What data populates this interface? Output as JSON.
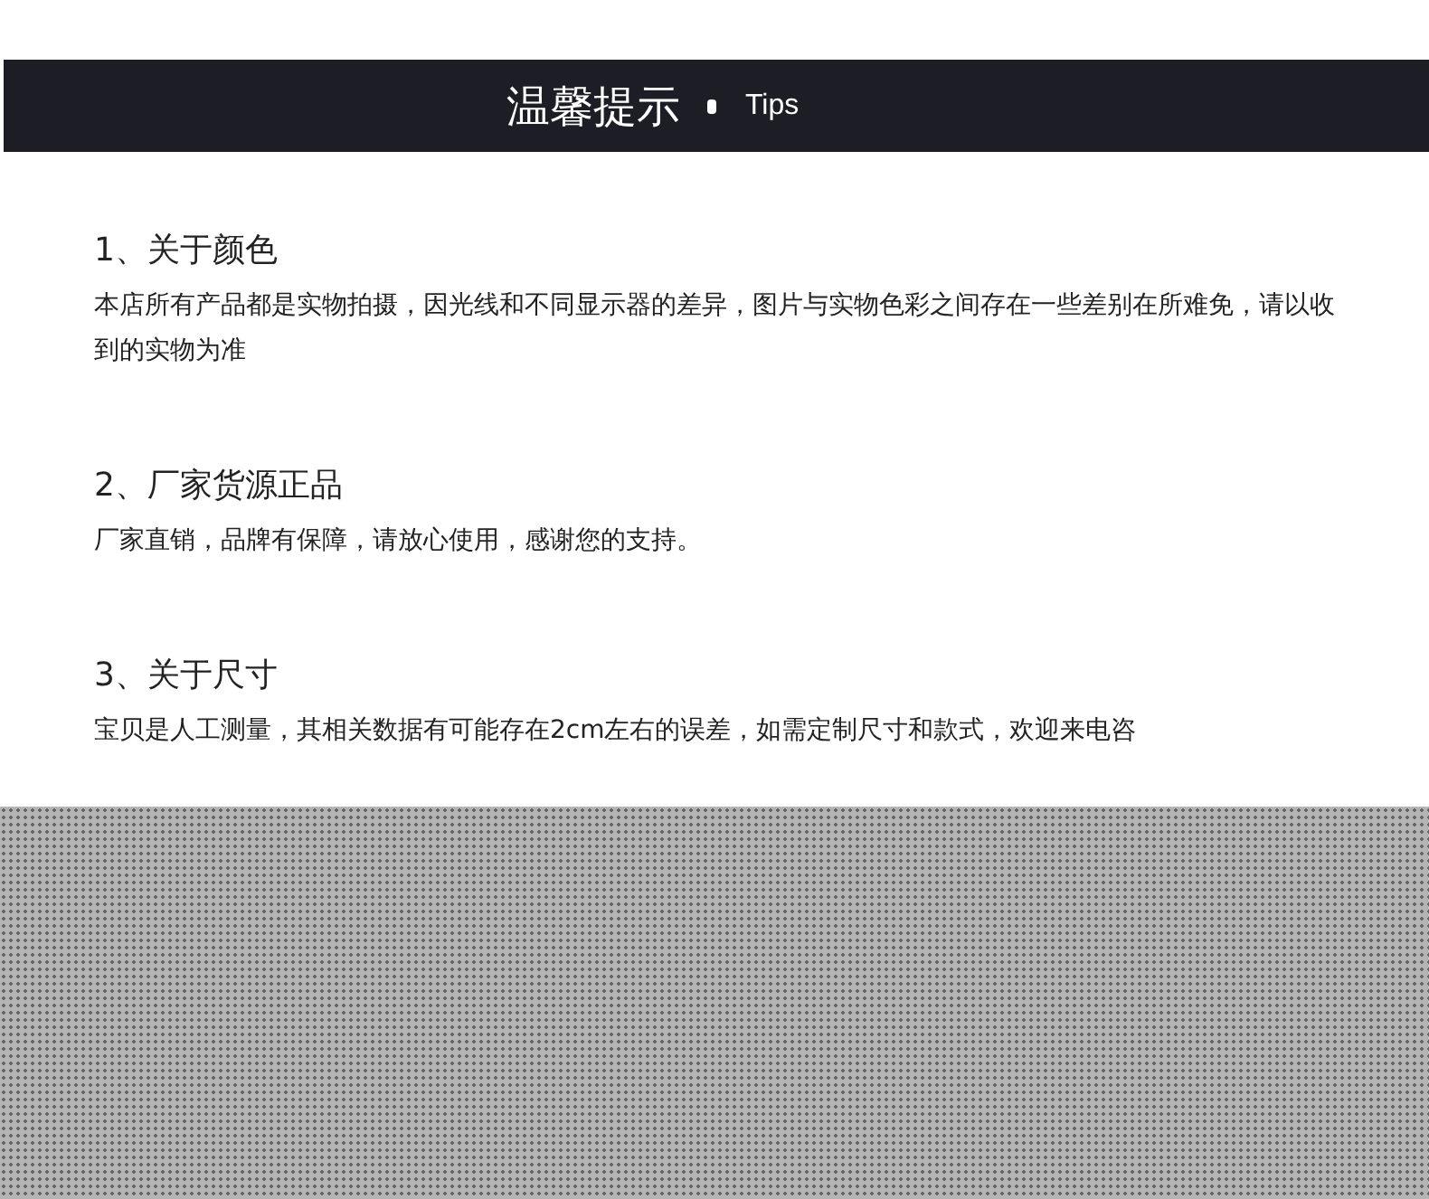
{
  "header": {
    "title": "温馨提示",
    "subtitle": "Tips"
  },
  "sections": [
    {
      "heading": "1、关于颜色",
      "text": "本店所有产品都是实物拍摄，因光线和不同显示器的差异，图片与实物色彩之间存在一些差别在所难免，请以收到的实物为准"
    },
    {
      "heading": "2、厂家货源正品",
      "text": "厂家直销，品牌有保障，请放心使用，感谢您的支持。"
    },
    {
      "heading": "3、关于尺寸",
      "text": "宝贝是人工测量，其相关数据有可能存在2cm左右的误差，如需定制尺寸和款式，欢迎来电咨"
    }
  ]
}
